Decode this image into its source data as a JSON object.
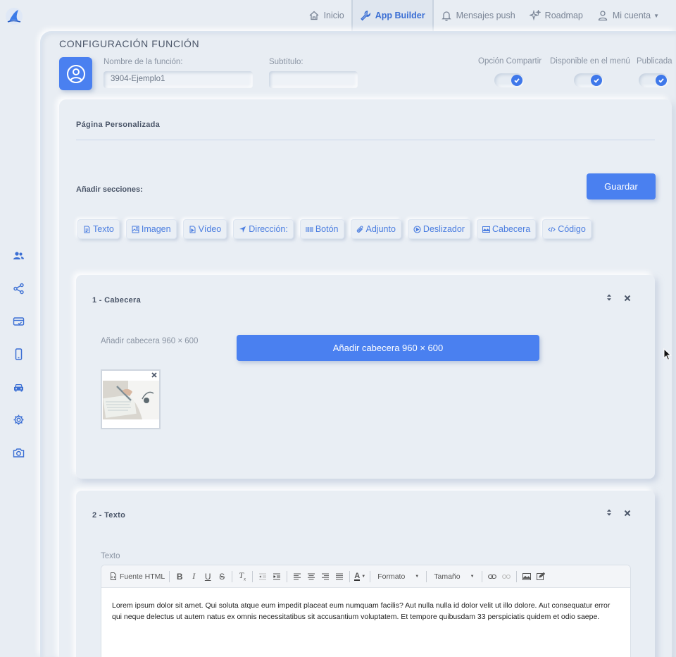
{
  "nav": {
    "items": [
      {
        "label": "Inicio",
        "icon": "home-icon"
      },
      {
        "label": "App Builder",
        "icon": "wrench-icon",
        "active": true
      },
      {
        "label": "Mensajes push",
        "icon": "bell-icon"
      },
      {
        "label": "Roadmap",
        "icon": "sparkle-icon"
      },
      {
        "label": "Mi cuenta",
        "icon": "user-icon"
      }
    ]
  },
  "sidebar": {
    "icons": [
      "users-icon",
      "share-icon",
      "card-check-icon",
      "phone-icon",
      "car-icon",
      "gear-icon",
      "camera-icon"
    ]
  },
  "header": {
    "title": "CONFIGURACIÓN FUNCIÓN",
    "name_label": "Nombre de la función:",
    "name_value": "3904-Ejemplo1",
    "subtitle_label": "Subtítulo:",
    "subtitle_value": "",
    "toggles": [
      {
        "label": "Opción Compartir",
        "on": true
      },
      {
        "label": "Disponible en el menú",
        "on": true
      },
      {
        "label": "Publicada",
        "on": true
      }
    ]
  },
  "page": {
    "title": "Página Personalizada",
    "add_sections_label": "Añadir secciones:",
    "save_label": "Guardar",
    "chips": [
      {
        "label": "Texto",
        "icon": "file-text-icon"
      },
      {
        "label": "Imagen",
        "icon": "image-icon"
      },
      {
        "label": "Vídeo",
        "icon": "video-file-icon"
      },
      {
        "label": "Dirección:",
        "icon": "location-arrow-icon"
      },
      {
        "label": "Botón",
        "icon": "barcode-icon"
      },
      {
        "label": "Adjunto",
        "icon": "paperclip-icon"
      },
      {
        "label": "Deslizador",
        "icon": "play-circle-icon"
      },
      {
        "label": "Cabecera",
        "icon": "picture-icon"
      },
      {
        "label": "Código",
        "icon": "code-icon"
      }
    ]
  },
  "section1": {
    "title": "1 - Cabecera",
    "sub_label": "Añadir cabecera 960 × 600",
    "button_label": "Añadir cabecera 960 × 600"
  },
  "section2": {
    "title": "2 - Texto",
    "sub_label": "Texto",
    "toolbar": {
      "source_label": "Fuente HTML",
      "format_label": "Formato",
      "size_label": "Tamaño"
    },
    "content": "Lorem ipsum dolor sit amet. Qui soluta atque eum impedit placeat eum numquam facilis? Aut nulla nulla id dolor velit ut illo dolore. Aut consequatur error qui neque delectus ut autem natus ex omnis necessitatibus sit accusantium voluptatem. Et tempore quibusdam 33 perspiciatis quidem et odio saepe."
  },
  "colors": {
    "accent": "#4a80f0",
    "background": "#e8edf3",
    "text": "#4a5568"
  }
}
